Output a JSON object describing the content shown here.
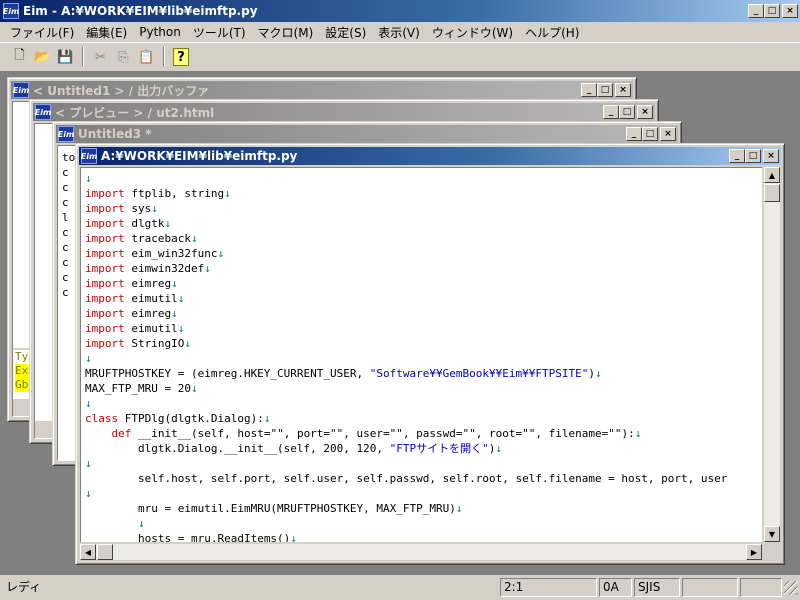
{
  "app": {
    "title": "Eim - A:¥WORK¥EIM¥lib¥eimftp.py",
    "icon_text": "Eim",
    "caption": {
      "minimize": "_",
      "maximize": "□",
      "close": "×"
    }
  },
  "menu": [
    "ファイル(F)",
    "編集(E)",
    "Python",
    "ツール(T)",
    "マクロ(M)",
    "設定(S)",
    "表示(V)",
    "ウィンドウ(W)",
    "ヘルプ(H)"
  ],
  "toolbar": {
    "icons": [
      "new-file-icon",
      "open-folder-icon",
      "save-icon",
      "cut-icon",
      "copy-icon",
      "paste-icon",
      "help-icon"
    ],
    "glyphs": {
      "new": "🗋",
      "open": "📂",
      "save": "💾",
      "cut": "✂",
      "copy": "⎘",
      "paste": "📋",
      "help": "?"
    }
  },
  "windows": {
    "w1_title": "< Untitled1 > / 出力バッファ",
    "w2_title": "< プレビュー > / ut2.html",
    "w3_title": "Untitled3 *",
    "w4_title": "A:¥WORK¥EIM¥lib¥eimftp.py",
    "w3_lines": [
      "to",
      "c",
      "c",
      "c",
      "l",
      "c",
      "c",
      "c",
      "c",
      "c"
    ],
    "w1_output": [
      "Ty",
      "Ex",
      "Gb"
    ]
  },
  "editor": {
    "lines": [
      {
        "t": "",
        "k": ""
      },
      {
        "t": "ftplib, string",
        "k": "import"
      },
      {
        "t": "sys",
        "k": "import"
      },
      {
        "t": "dlgtk",
        "k": "import"
      },
      {
        "t": "traceback",
        "k": "import"
      },
      {
        "t": "eim_win32func",
        "k": "import"
      },
      {
        "t": "eimwin32def",
        "k": "import"
      },
      {
        "t": "eimreg",
        "k": "import"
      },
      {
        "t": "eimutil",
        "k": "import"
      },
      {
        "t": "eimreg",
        "k": "import"
      },
      {
        "t": "eimutil",
        "k": "import"
      },
      {
        "t": "StringIO",
        "k": "import"
      },
      {
        "t": "",
        "k": ""
      },
      {
        "t": "MRUFTPHOSTKEY = (eimreg.HKEY_CURRENT_USER, ",
        "k": "",
        "s": "\"Software¥¥GemBook¥¥Eim¥¥FTPSITE\"",
        "after": ")"
      },
      {
        "t": "MAX_FTP_MRU = 20",
        "k": ""
      },
      {
        "t": "",
        "k": ""
      },
      {
        "t": "FTPDlg(dlgtk.Dialog):",
        "k": "class"
      },
      {
        "t": "__init__(self, host=\"\", port=\"\", user=\"\", passwd=\"\", root=\"\", filename=\"\"):",
        "k": "def",
        "indent": "    "
      },
      {
        "t": "dlgtk.Dialog.__init__(self, 200, 120, ",
        "k": "",
        "indent": "        ",
        "s": "\"FTPサイトを開く\"",
        "after": ")"
      },
      {
        "t": "",
        "k": ""
      },
      {
        "t": "self.host, self.port, self.user, self.passwd, self.root, self.filename = host, port, user",
        "k": "",
        "indent": "        ",
        "nonl": true
      },
      {
        "t": "",
        "k": ""
      },
      {
        "t": "mru = eimutil.EimMRU(MRUFTPHOSTKEY, MAX_FTP_MRU)",
        "k": "",
        "indent": "        "
      },
      {
        "t": "",
        "k": "",
        "indent": "        "
      },
      {
        "t": "hosts = mru.ReadItems()",
        "k": "",
        "indent": "        "
      }
    ],
    "newline_mark": "↓"
  },
  "status": {
    "message": "レディ",
    "position": "2:1",
    "code": "0A",
    "encoding": "SJIS",
    "extra1": "",
    "extra2": ""
  }
}
